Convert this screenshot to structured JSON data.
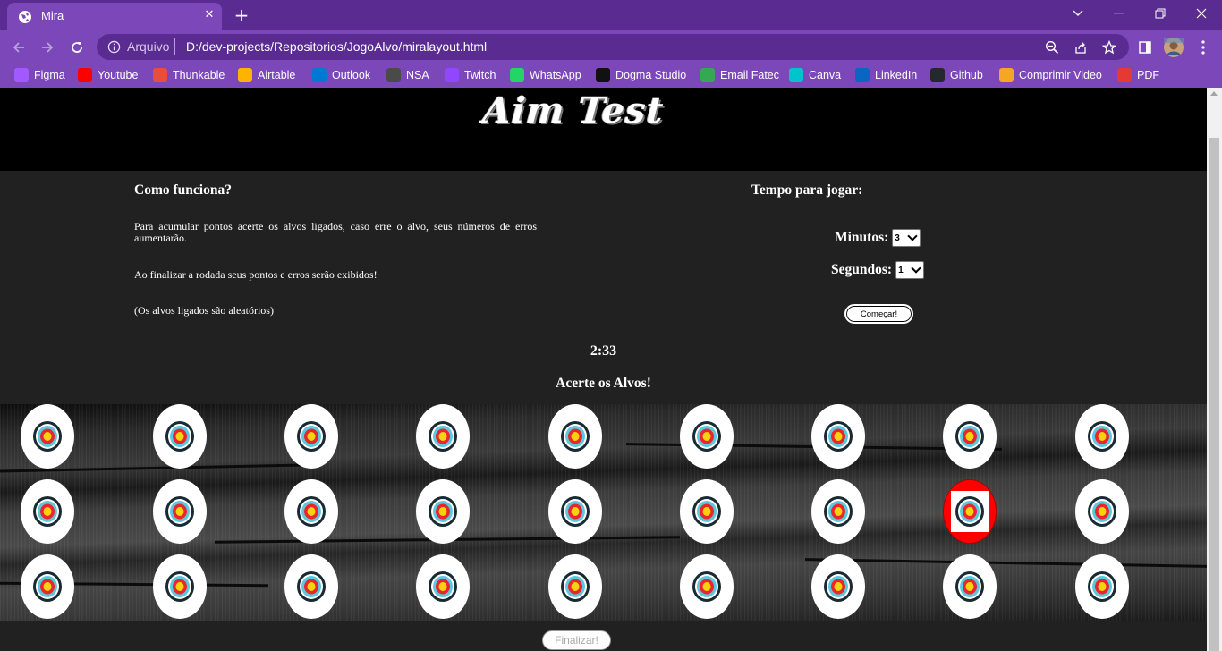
{
  "browser": {
    "tab": {
      "title": "Mira"
    },
    "address": {
      "scheme": "Arquivo",
      "url": "D:/dev-projects/Repositorios/JogoAlvo/miralayout.html"
    },
    "bookmarks": [
      {
        "label": "Figma",
        "icon": "figma-icon",
        "color": "#a259ff"
      },
      {
        "label": "Youtube",
        "icon": "youtube-icon",
        "color": "#ff0000"
      },
      {
        "label": "Thunkable",
        "icon": "thunkable-icon",
        "color": "#e94e3d"
      },
      {
        "label": "Airtable",
        "icon": "airtable-icon",
        "color": "#fcb400"
      },
      {
        "label": "Outlook",
        "icon": "outlook-icon",
        "color": "#0078d4"
      },
      {
        "label": "NSA",
        "icon": "nsa-icon",
        "color": "#4a4a4a"
      },
      {
        "label": "Twitch",
        "icon": "twitch-icon",
        "color": "#9146ff"
      },
      {
        "label": "WhatsApp",
        "icon": "whatsapp-icon",
        "color": "#25d366"
      },
      {
        "label": "Dogma Studio",
        "icon": "dogma-icon",
        "color": "#111111"
      },
      {
        "label": "Email Fatec",
        "icon": "email-fatec-icon",
        "color": "#34a853"
      },
      {
        "label": "Canva",
        "icon": "canva-icon",
        "color": "#00c4cc"
      },
      {
        "label": "LinkedIn",
        "icon": "linkedin-icon",
        "color": "#0a66c2"
      },
      {
        "label": "Github",
        "icon": "github-icon",
        "color": "#24292f"
      },
      {
        "label": "Comprimir Video",
        "icon": "compress-video-icon",
        "color": "#f5a623"
      },
      {
        "label": "PDF",
        "icon": "pdf-icon",
        "color": "#e53935"
      }
    ]
  },
  "page": {
    "logo": "Aim Test",
    "how": {
      "title": "Como funciona?",
      "p1": "Para acumular pontos acerte os alvos ligados, caso erre o alvo, seus números de erros aumentarão.",
      "p2": "Ao finalizar a rodada seus pontos e erros serão exibidos!",
      "p3": "(Os alvos ligados são aleatórios)"
    },
    "time": {
      "title": "Tempo para jogar:",
      "minutes_label": "Minutos:",
      "minutes_value": "3",
      "seconds_label": "Segundos:",
      "seconds_value": "1",
      "start_label": "Começar!"
    },
    "timer": "2:33",
    "hit_title": "Acerte os Alvos!",
    "grid": {
      "rows": 3,
      "cols": 9,
      "active": {
        "row": 2,
        "col": 8
      },
      "active_color": "#ff0000"
    },
    "finish_label": "Finalizar!"
  }
}
